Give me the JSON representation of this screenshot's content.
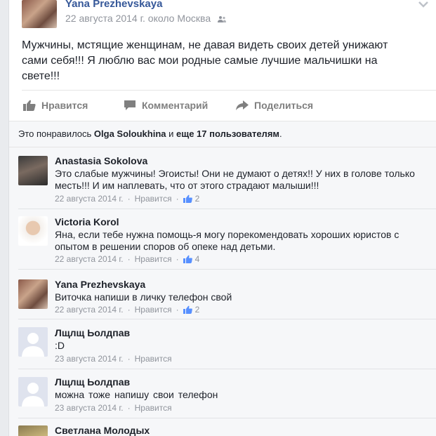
{
  "post": {
    "author": "Yana Prezhevskaya",
    "meta": "22 августа 2014 г. около Москва",
    "text": "Мужчины, мстящие женщинам, не давая видеть своих детей унижают сами себя!!! Я люблю вас мои родные самые лучшие мальчишки на свете!!!"
  },
  "actions": {
    "like": "Нравится",
    "comment": "Комментарий",
    "share": "Поделиться"
  },
  "likes": {
    "prefix": "Это понравилось ",
    "name": "Olga Soloukhina",
    "middle": " и ",
    "others": "еще 17 пользователям",
    "suffix": "."
  },
  "comments": [
    {
      "name": "Anastasia Sokolova",
      "text": "Это слабые мужчины! Эгоисты! Они не думают о детях!! У них в голове только месть!!! И им наплевать, что от этого страдают малыши!!!",
      "date": "22 августа 2014 г.",
      "like": "Нравится",
      "likes_count": "2"
    },
    {
      "name": "Victoria Korol",
      "text": "Яна, если тебе нужна помощь-я могу порекомендовать хороших юристов с опытом в решении споров об опеке над детьми.",
      "date": "22 августа 2014 г.",
      "like": "Нравится",
      "likes_count": "4"
    },
    {
      "name": "Yana Prezhevskaya",
      "text": "Виточка напиши в личку телефон свой",
      "date": "22 августа 2014 г.",
      "like": "Нравится",
      "likes_count": "2"
    },
    {
      "name": "Лщлщ Ьолдпав",
      "text": ":D",
      "date": "23 августа 2014 г.",
      "like": "Нравится",
      "likes_count": ""
    },
    {
      "name": "Лщлщ Ьолдпав",
      "text": "можна  тоже  напишу  свои  телефон",
      "date": "23 августа 2014 г.",
      "like": "Нравится",
      "likes_count": ""
    },
    {
      "name": "Светлана Молодых",
      "text": "",
      "date": "",
      "like": "",
      "likes_count": ""
    }
  ],
  "colors": {
    "link": "#365899",
    "meta": "#90949c",
    "action": "#7f7f7f",
    "comments_bg": "#f6f7f9"
  },
  "icons": {
    "audience": "friends-icon",
    "menu": "chevron-down-icon",
    "like": "thumbs-up-icon",
    "comment": "speech-bubble-icon",
    "share": "share-arrow-icon"
  }
}
